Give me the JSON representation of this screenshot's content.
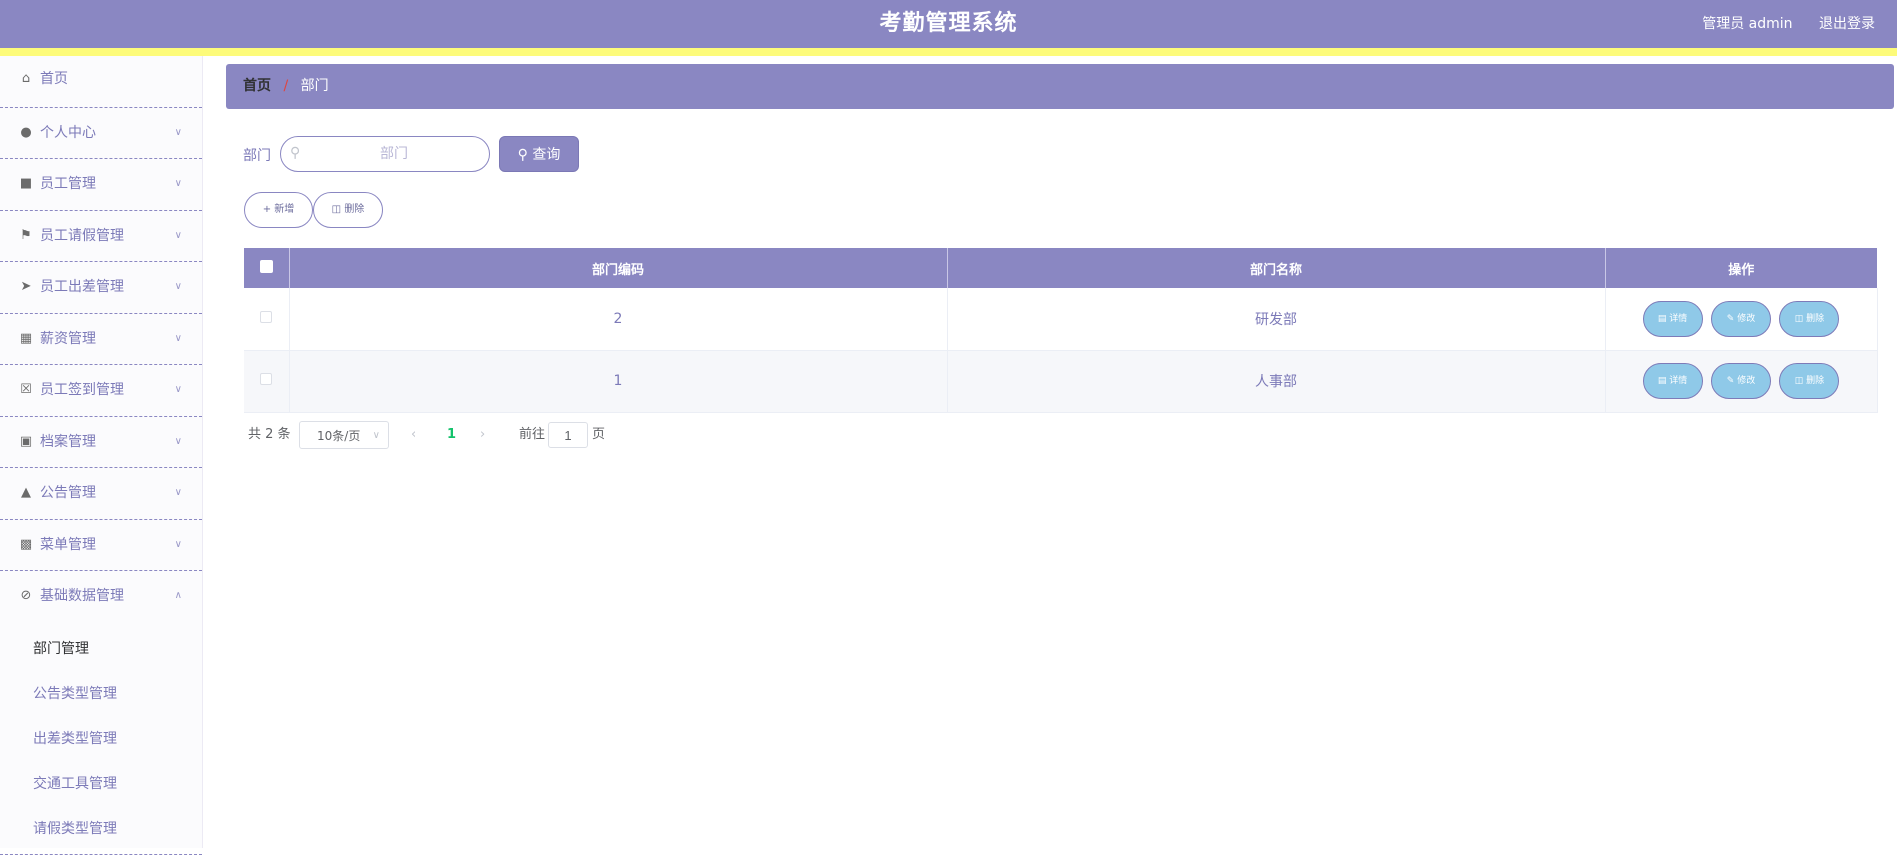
{
  "header": {
    "title": "考勤管理系统",
    "user_label": "管理员 admin",
    "logout_label": "退出登录"
  },
  "colors": {
    "primary": "#8a87c2",
    "stripe": "#fdfb7a",
    "op_button": "#8fc9e8"
  },
  "sidebar": {
    "items": [
      {
        "label": "首页",
        "icon": "home-icon"
      },
      {
        "label": "个人中心",
        "icon": "user-icon"
      },
      {
        "label": "员工管理",
        "icon": "briefcase-icon"
      },
      {
        "label": "员工请假管理",
        "icon": "flag-icon"
      },
      {
        "label": "员工出差管理",
        "icon": "send-icon"
      },
      {
        "label": "薪资管理",
        "icon": "grid-icon"
      },
      {
        "label": "员工签到管理",
        "icon": "clipboard-x-icon"
      },
      {
        "label": "档案管理",
        "icon": "clipboard-icon"
      },
      {
        "label": "公告管理",
        "icon": "megaphone-user-icon"
      },
      {
        "label": "菜单管理",
        "icon": "store-icon"
      },
      {
        "label": "基础数据管理",
        "icon": "bell-off-icon"
      }
    ],
    "submenu": [
      "部门管理",
      "公告类型管理",
      "出差类型管理",
      "交通工具管理",
      "请假类型管理"
    ]
  },
  "breadcrumb": {
    "home": "首页",
    "separator": "/",
    "current": "部门"
  },
  "search": {
    "label": "部门",
    "placeholder": "部门",
    "button_label": "查询"
  },
  "actions": {
    "add_label": "新增",
    "delete_label": "删除"
  },
  "table": {
    "columns": [
      "部门编码",
      "部门名称",
      "操作"
    ],
    "rows": [
      {
        "code": "2",
        "name": "研发部"
      },
      {
        "code": "1",
        "name": "人事部"
      }
    ],
    "row_buttons": {
      "detail": "详情",
      "edit": "修改",
      "delete": "删除"
    }
  },
  "pagination": {
    "total_text": "共 2 条",
    "page_size": "10条/页",
    "current_page": "1",
    "goto_label": "前往",
    "goto_value": "1",
    "page_suffix": "页"
  }
}
